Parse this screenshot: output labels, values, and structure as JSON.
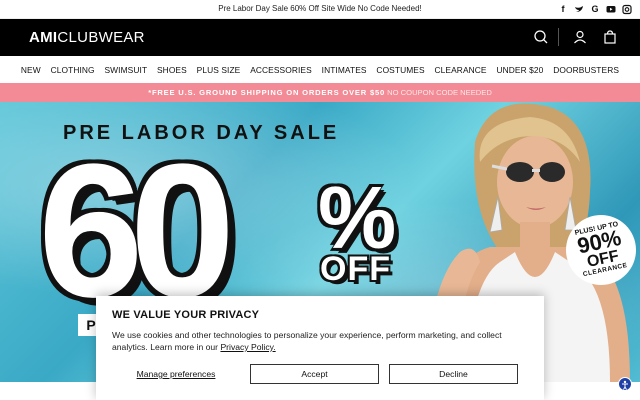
{
  "announcement": {
    "text": "Pre Labor Day Sale 60% Off Site Wide No Code Needed!",
    "social": [
      {
        "icon": "facebook-icon",
        "glyph": "f"
      },
      {
        "icon": "twitter-icon",
        "glyph": "t"
      },
      {
        "icon": "google-icon",
        "glyph": "G"
      },
      {
        "icon": "youtube-icon",
        "glyph": "▶"
      },
      {
        "icon": "instagram-icon",
        "glyph": "◎"
      }
    ]
  },
  "header": {
    "logo_bold": "AMI",
    "logo_light": "CLUBWEAR",
    "icons": [
      "search-icon",
      "user-icon",
      "cart-icon"
    ]
  },
  "nav": {
    "items": [
      "NEW",
      "CLOTHING",
      "SWIMSUIT",
      "SHOES",
      "PLUS SIZE",
      "ACCESSORIES",
      "INTIMATES",
      "COSTUMES",
      "CLEARANCE",
      "UNDER $20",
      "DOORBUSTERS"
    ]
  },
  "promo": {
    "bold": "*FREE U.S. GROUND SHIPPING ON ORDERS OVER $50",
    "light": "NO COUPON CODE NEEDED"
  },
  "hero": {
    "title": "PRE LABOR DAY SALE",
    "number": "60",
    "percent": "%",
    "off": "OFF",
    "plus_tag": "P",
    "badge": {
      "line1": "PLUS! UP TO",
      "line2": "90%",
      "line3": "OFF",
      "line4": "CLEARANCE"
    }
  },
  "privacy": {
    "title": "WE VALUE YOUR PRIVACY",
    "body": "We use cookies and other technologies to personalize your experience, perform marketing, and collect analytics. Learn more in our",
    "link": "Privacy Policy.",
    "manage": "Manage preferences",
    "accept": "Accept",
    "decline": "Decline"
  },
  "colors": {
    "header_bg": "#000000",
    "promo_bg": "#f28b95",
    "pool": "#3aa9c6",
    "a11y": "#1f3fa8"
  }
}
